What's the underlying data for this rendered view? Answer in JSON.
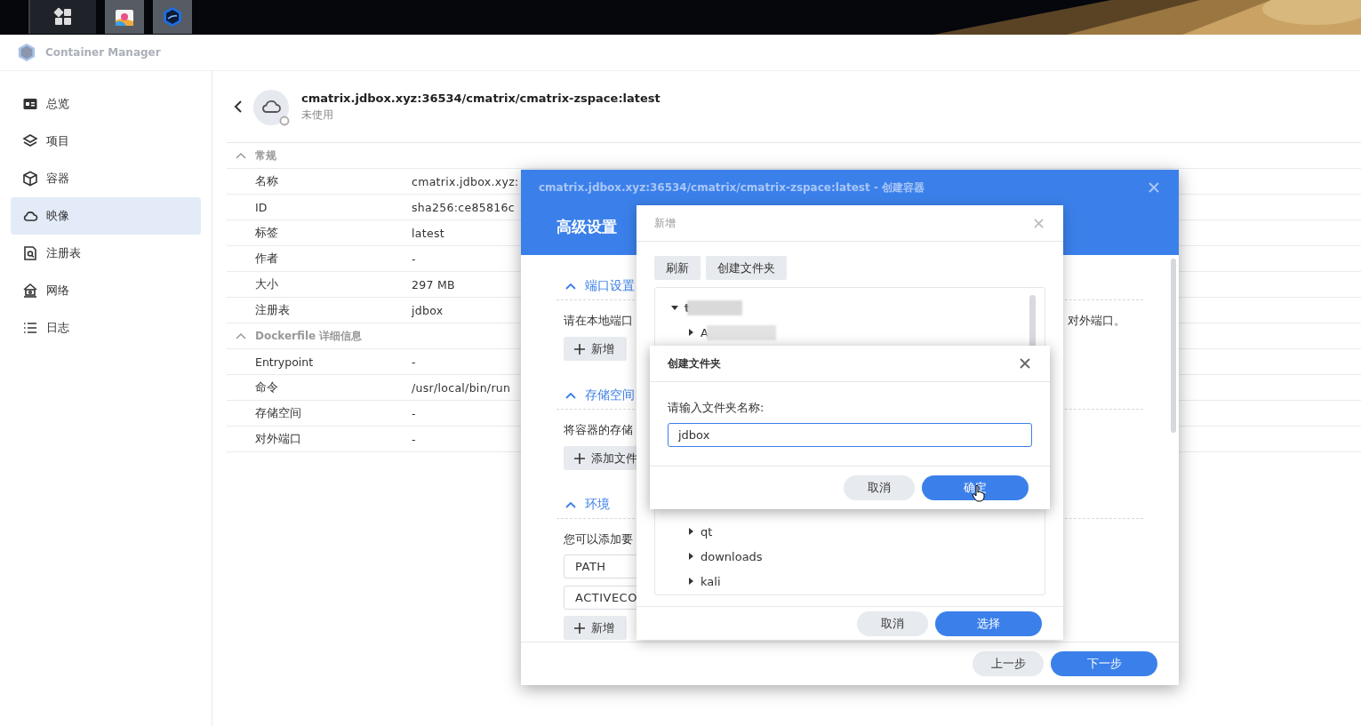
{
  "taskbar": {
    "items": [
      {
        "kind": "grid",
        "selected": false
      },
      {
        "kind": "store",
        "selected": true
      },
      {
        "kind": "app",
        "selected": true
      }
    ]
  },
  "app": {
    "title": "Container Manager"
  },
  "sidebar": {
    "items": [
      {
        "label": "总览",
        "selected": false
      },
      {
        "label": "项目",
        "selected": false
      },
      {
        "label": "容器",
        "selected": false
      },
      {
        "label": "映像",
        "selected": true
      },
      {
        "label": "注册表",
        "selected": false
      },
      {
        "label": "网络",
        "selected": false
      },
      {
        "label": "日志",
        "selected": false
      }
    ]
  },
  "image": {
    "title": "cmatrix.jdbox.xyz:36534/cmatrix/cmatrix-zspace:latest",
    "status": "未使用"
  },
  "details": [
    {
      "section": "常规",
      "expanded": true,
      "rows": [
        {
          "label": "名称",
          "value": "cmatrix.jdbox.xyz:"
        },
        {
          "label": "ID",
          "value": "sha256:ce85816c"
        },
        {
          "label": "标签",
          "value": "latest"
        },
        {
          "label": "作者",
          "value": "-"
        },
        {
          "label": "大小",
          "value": "297 MB"
        },
        {
          "label": "注册表",
          "value": "jdbox"
        }
      ]
    },
    {
      "section": "Dockerfile 详细信息",
      "expanded": true,
      "rows": [
        {
          "label": "Entrypoint",
          "value": "-"
        },
        {
          "label": "命令",
          "value": "/usr/local/bin/run"
        },
        {
          "label": "存储空间",
          "value": "-"
        },
        {
          "label": "对外端口",
          "value": "-"
        }
      ]
    }
  ],
  "wizard": {
    "title": "cmatrix.jdbox.xyz:36534/cmatrix/cmatrix-zspace:latest - 创建容器",
    "heading": "高级设置",
    "sections": [
      {
        "title": "端口设置",
        "expanded": true,
        "text": "请在本地端口",
        "text_right": "对外端口。",
        "button": "新增"
      },
      {
        "title": "存储空间",
        "expanded": true,
        "text": "将容器的存储",
        "button": "添加文件"
      },
      {
        "title": "环境",
        "expanded": true,
        "text": "您可以添加要",
        "fields": [
          "PATH",
          "ACTIVECO"
        ],
        "button": "新增"
      }
    ],
    "buttons": [
      {
        "label": "上一步",
        "primary": false
      },
      {
        "label": "下一步",
        "primary": true
      }
    ]
  },
  "folder_picker": {
    "title": "新增",
    "toolbar": [
      "刷新",
      "创建文件夹"
    ],
    "tree": [
      {
        "label": "t",
        "expanded": true,
        "redacted": true,
        "children": [
          {
            "label": "A",
            "expanded": false,
            "redacted": true
          },
          {
            "label": "qt",
            "expanded": false
          },
          {
            "label": "downloads",
            "expanded": false
          },
          {
            "label": "kali",
            "expanded": false
          }
        ]
      }
    ],
    "buttons": [
      {
        "label": "取消",
        "primary": false
      },
      {
        "label": "选择",
        "primary": true
      }
    ]
  },
  "create_folder": {
    "title": "创建文件夹",
    "prompt": "请输入文件夹名称:",
    "value": "jdbox",
    "buttons": [
      {
        "label": "取消",
        "primary": false
      },
      {
        "label": "确定",
        "primary": true
      }
    ]
  }
}
